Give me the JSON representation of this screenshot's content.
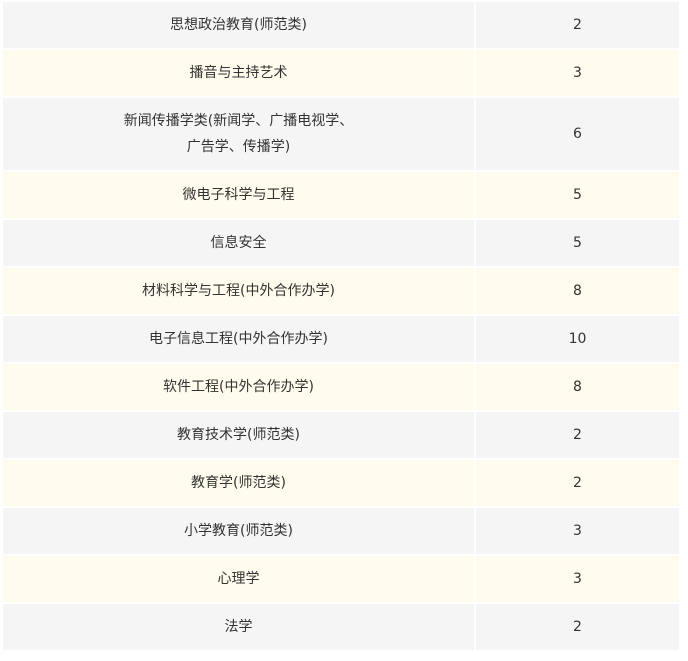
{
  "table": {
    "rows": [
      {
        "major": "思想政治教育(师范类)",
        "count": "2"
      },
      {
        "major": "播音与主持艺术",
        "count": "3"
      },
      {
        "major": "新闻传播学类(新闻学、广播电视学、\n广告学、传播学)",
        "count": "6"
      },
      {
        "major": "微电子科学与工程",
        "count": "5"
      },
      {
        "major": "信息安全",
        "count": "5"
      },
      {
        "major": "材料科学与工程(中外合作办学)",
        "count": "8"
      },
      {
        "major": "电子信息工程(中外合作办学)",
        "count": "10"
      },
      {
        "major": "软件工程(中外合作办学)",
        "count": "8"
      },
      {
        "major": "教育技术学(师范类)",
        "count": "2"
      },
      {
        "major": "教育学(师范类)",
        "count": "2"
      },
      {
        "major": "小学教育(师范类)",
        "count": "3"
      },
      {
        "major": "心理学",
        "count": "3"
      },
      {
        "major": "法学",
        "count": "2"
      }
    ]
  },
  "colors": {
    "row_odd": "#f5f5f5",
    "row_even": "#fffbed",
    "text": "#333333"
  }
}
